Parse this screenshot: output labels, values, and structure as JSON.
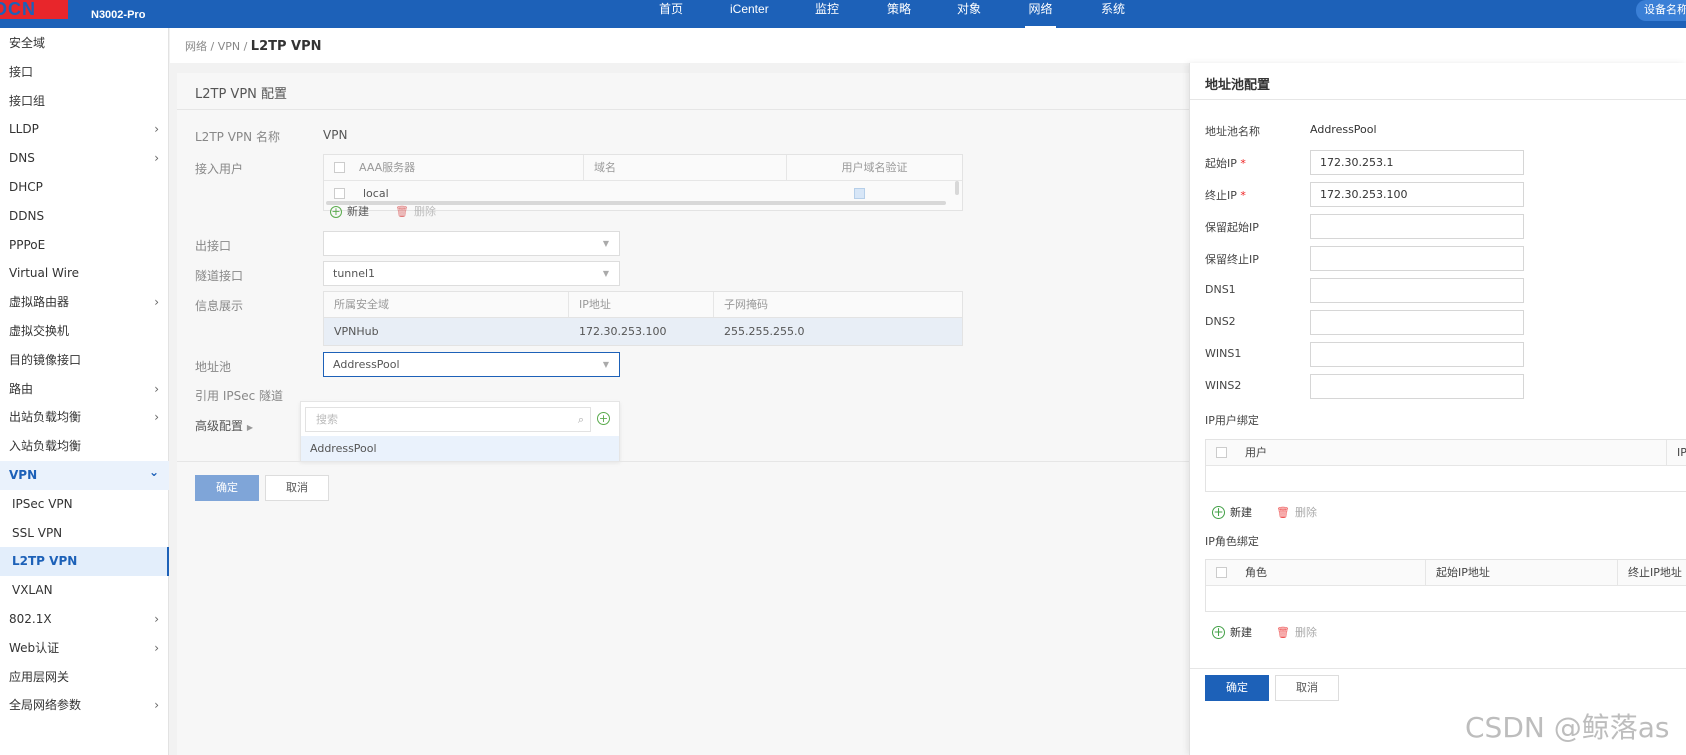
{
  "topbar": {
    "logo": "DCN",
    "model": "N3002-Pro",
    "nav": [
      {
        "label": "首页",
        "active": false
      },
      {
        "label": "iCenter",
        "active": false
      },
      {
        "label": "监控",
        "active": false
      },
      {
        "label": "策略",
        "active": false
      },
      {
        "label": "对象",
        "active": false
      },
      {
        "label": "网络",
        "active": true
      },
      {
        "label": "系统",
        "active": false
      }
    ],
    "device_name": "设备名称"
  },
  "sidebar": {
    "items": [
      {
        "label": "安全域",
        "chevron": ""
      },
      {
        "label": "接口",
        "chevron": ""
      },
      {
        "label": "接口组",
        "chevron": ""
      },
      {
        "label": "LLDP",
        "chevron": "›"
      },
      {
        "label": "DNS",
        "chevron": "›"
      },
      {
        "label": "DHCP",
        "chevron": ""
      },
      {
        "label": "DDNS",
        "chevron": ""
      },
      {
        "label": "PPPoE",
        "chevron": ""
      },
      {
        "label": "Virtual Wire",
        "chevron": ""
      },
      {
        "label": "虚拟路由器",
        "chevron": "›"
      },
      {
        "label": "虚拟交换机",
        "chevron": ""
      },
      {
        "label": "目的镜像接口",
        "chevron": ""
      },
      {
        "label": "路由",
        "chevron": "›"
      },
      {
        "label": "出站负载均衡",
        "chevron": "›"
      },
      {
        "label": "入站负载均衡",
        "chevron": ""
      },
      {
        "label": "VPN",
        "chevron": "⌄",
        "expanded": true
      },
      {
        "label": "IPSec VPN",
        "chevron": "",
        "sub": true
      },
      {
        "label": "SSL VPN",
        "chevron": "",
        "sub": true
      },
      {
        "label": "L2TP VPN",
        "chevron": "",
        "sub": true,
        "selected": true
      },
      {
        "label": "VXLAN",
        "chevron": "",
        "sub": true
      },
      {
        "label": "802.1X",
        "chevron": "›"
      },
      {
        "label": "Web认证",
        "chevron": "›"
      },
      {
        "label": "应用层网关",
        "chevron": ""
      },
      {
        "label": "全局网络参数",
        "chevron": "›"
      }
    ]
  },
  "breadcrumb": {
    "path": "网络 / VPN / ",
    "current": "L2TP VPN"
  },
  "main": {
    "title": "L2TP VPN 配置",
    "name_label": "L2TP VPN 名称",
    "name_value": "VPN",
    "users_label": "接入用户",
    "users_table": {
      "headers": [
        "AAA服务器",
        "域名",
        "用户域名验证"
      ],
      "rows": [
        {
          "aaa": "local",
          "domain": "",
          "verify": true
        }
      ]
    },
    "new_label": "新建",
    "delete_label": "删除",
    "out_if_label": "出接口",
    "out_if_value": "",
    "tunnel_label": "隧道接口",
    "tunnel_value": "tunnel1",
    "info_label": "信息展示",
    "info_table": {
      "headers": [
        "所属安全域",
        "IP地址",
        "子网掩码"
      ],
      "row": [
        "VPNHub",
        "172.30.253.100",
        "255.255.255.0"
      ]
    },
    "pool_label": "地址池",
    "pool_value": "AddressPool",
    "ipsec_label": "引用 IPSec 隧道",
    "advanced_label": "高级配置",
    "dropdown": {
      "search_placeholder": "搜索",
      "options": [
        "AddressPool"
      ]
    },
    "ok_label": "确定",
    "cancel_label": "取消"
  },
  "drawer": {
    "title": "地址池配置",
    "fields": [
      {
        "label": "地址池名称",
        "required": false,
        "value": "AddressPool",
        "type": "text"
      },
      {
        "label": "起始IP",
        "required": true,
        "value": "172.30.253.1",
        "type": "input"
      },
      {
        "label": "终止IP",
        "required": true,
        "value": "172.30.253.100",
        "type": "input"
      },
      {
        "label": "保留起始IP",
        "required": false,
        "value": "",
        "type": "input"
      },
      {
        "label": "保留终止IP",
        "required": false,
        "value": "",
        "type": "input"
      },
      {
        "label": "DNS1",
        "required": false,
        "value": "",
        "type": "input"
      },
      {
        "label": "DNS2",
        "required": false,
        "value": "",
        "type": "input"
      },
      {
        "label": "WINS1",
        "required": false,
        "value": "",
        "type": "input"
      },
      {
        "label": "WINS2",
        "required": false,
        "value": "",
        "type": "input"
      }
    ],
    "user_bind": {
      "label": "IP用户绑定",
      "headers": [
        "用户",
        "IP"
      ]
    },
    "role_bind": {
      "label": "IP角色绑定",
      "headers": [
        "角色",
        "起始IP地址",
        "终止IP地址"
      ]
    },
    "new_label": "新建",
    "delete_label": "删除",
    "ok_label": "确定",
    "cancel_label": "取消",
    "required_mark": "*"
  },
  "watermark": "CSDN @鲸落as",
  "colors": {
    "brand": "#1d61b8",
    "required": "#e22222",
    "add": "#43a047",
    "delete": "#e55555"
  }
}
